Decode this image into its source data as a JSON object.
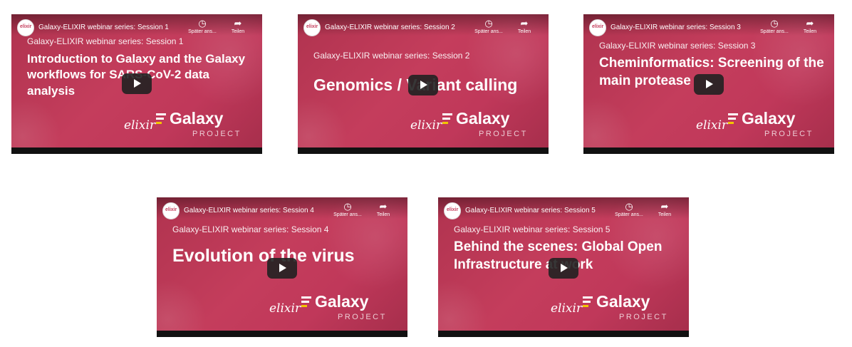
{
  "videos": [
    {
      "video_title": "Galaxy-ELIXIR webinar series: Session 1",
      "subtitle": "Galaxy-ELIXIR webinar series: Session 1",
      "headline": "Introduction to Galaxy and the Galaxy workflows for SARS-CoV-2 data analysis"
    },
    {
      "video_title": "Galaxy-ELIXIR webinar series: Session 2",
      "subtitle": "Galaxy-ELIXIR webinar series: Session 2",
      "headline": "Genomics / Variant calling"
    },
    {
      "video_title": "Galaxy-ELIXIR webinar series: Session 3",
      "subtitle": "Galaxy-ELIXIR webinar series: Session 3",
      "headline": "Cheminformatics: Screening of the main protease"
    },
    {
      "video_title": "Galaxy-ELIXIR webinar series: Session 4",
      "subtitle": "Galaxy-ELIXIR webinar series: Session 4",
      "headline": "Evolution of the virus"
    },
    {
      "video_title": "Galaxy-ELIXIR webinar series: Session 5",
      "subtitle": "Galaxy-ELIXIR webinar series: Session 5",
      "headline": "Behind the scenes: Global Open Infrastructure at work"
    }
  ],
  "actions": {
    "watch_later_label": "Später ans...",
    "share_label": "Teilen",
    "watch_later_icon": "clock-icon",
    "share_icon": "share-arrow-icon",
    "play_icon": "play-icon"
  },
  "branding": {
    "channel_avatar_text": "elixir",
    "elixir_logo": "elixir",
    "galaxy_logo": "Galaxy",
    "project_label": "PROJECT"
  },
  "colors": {
    "card_background": "#c43d5c",
    "play_button": "#212121",
    "galaxy_accent": "#f2c500"
  }
}
